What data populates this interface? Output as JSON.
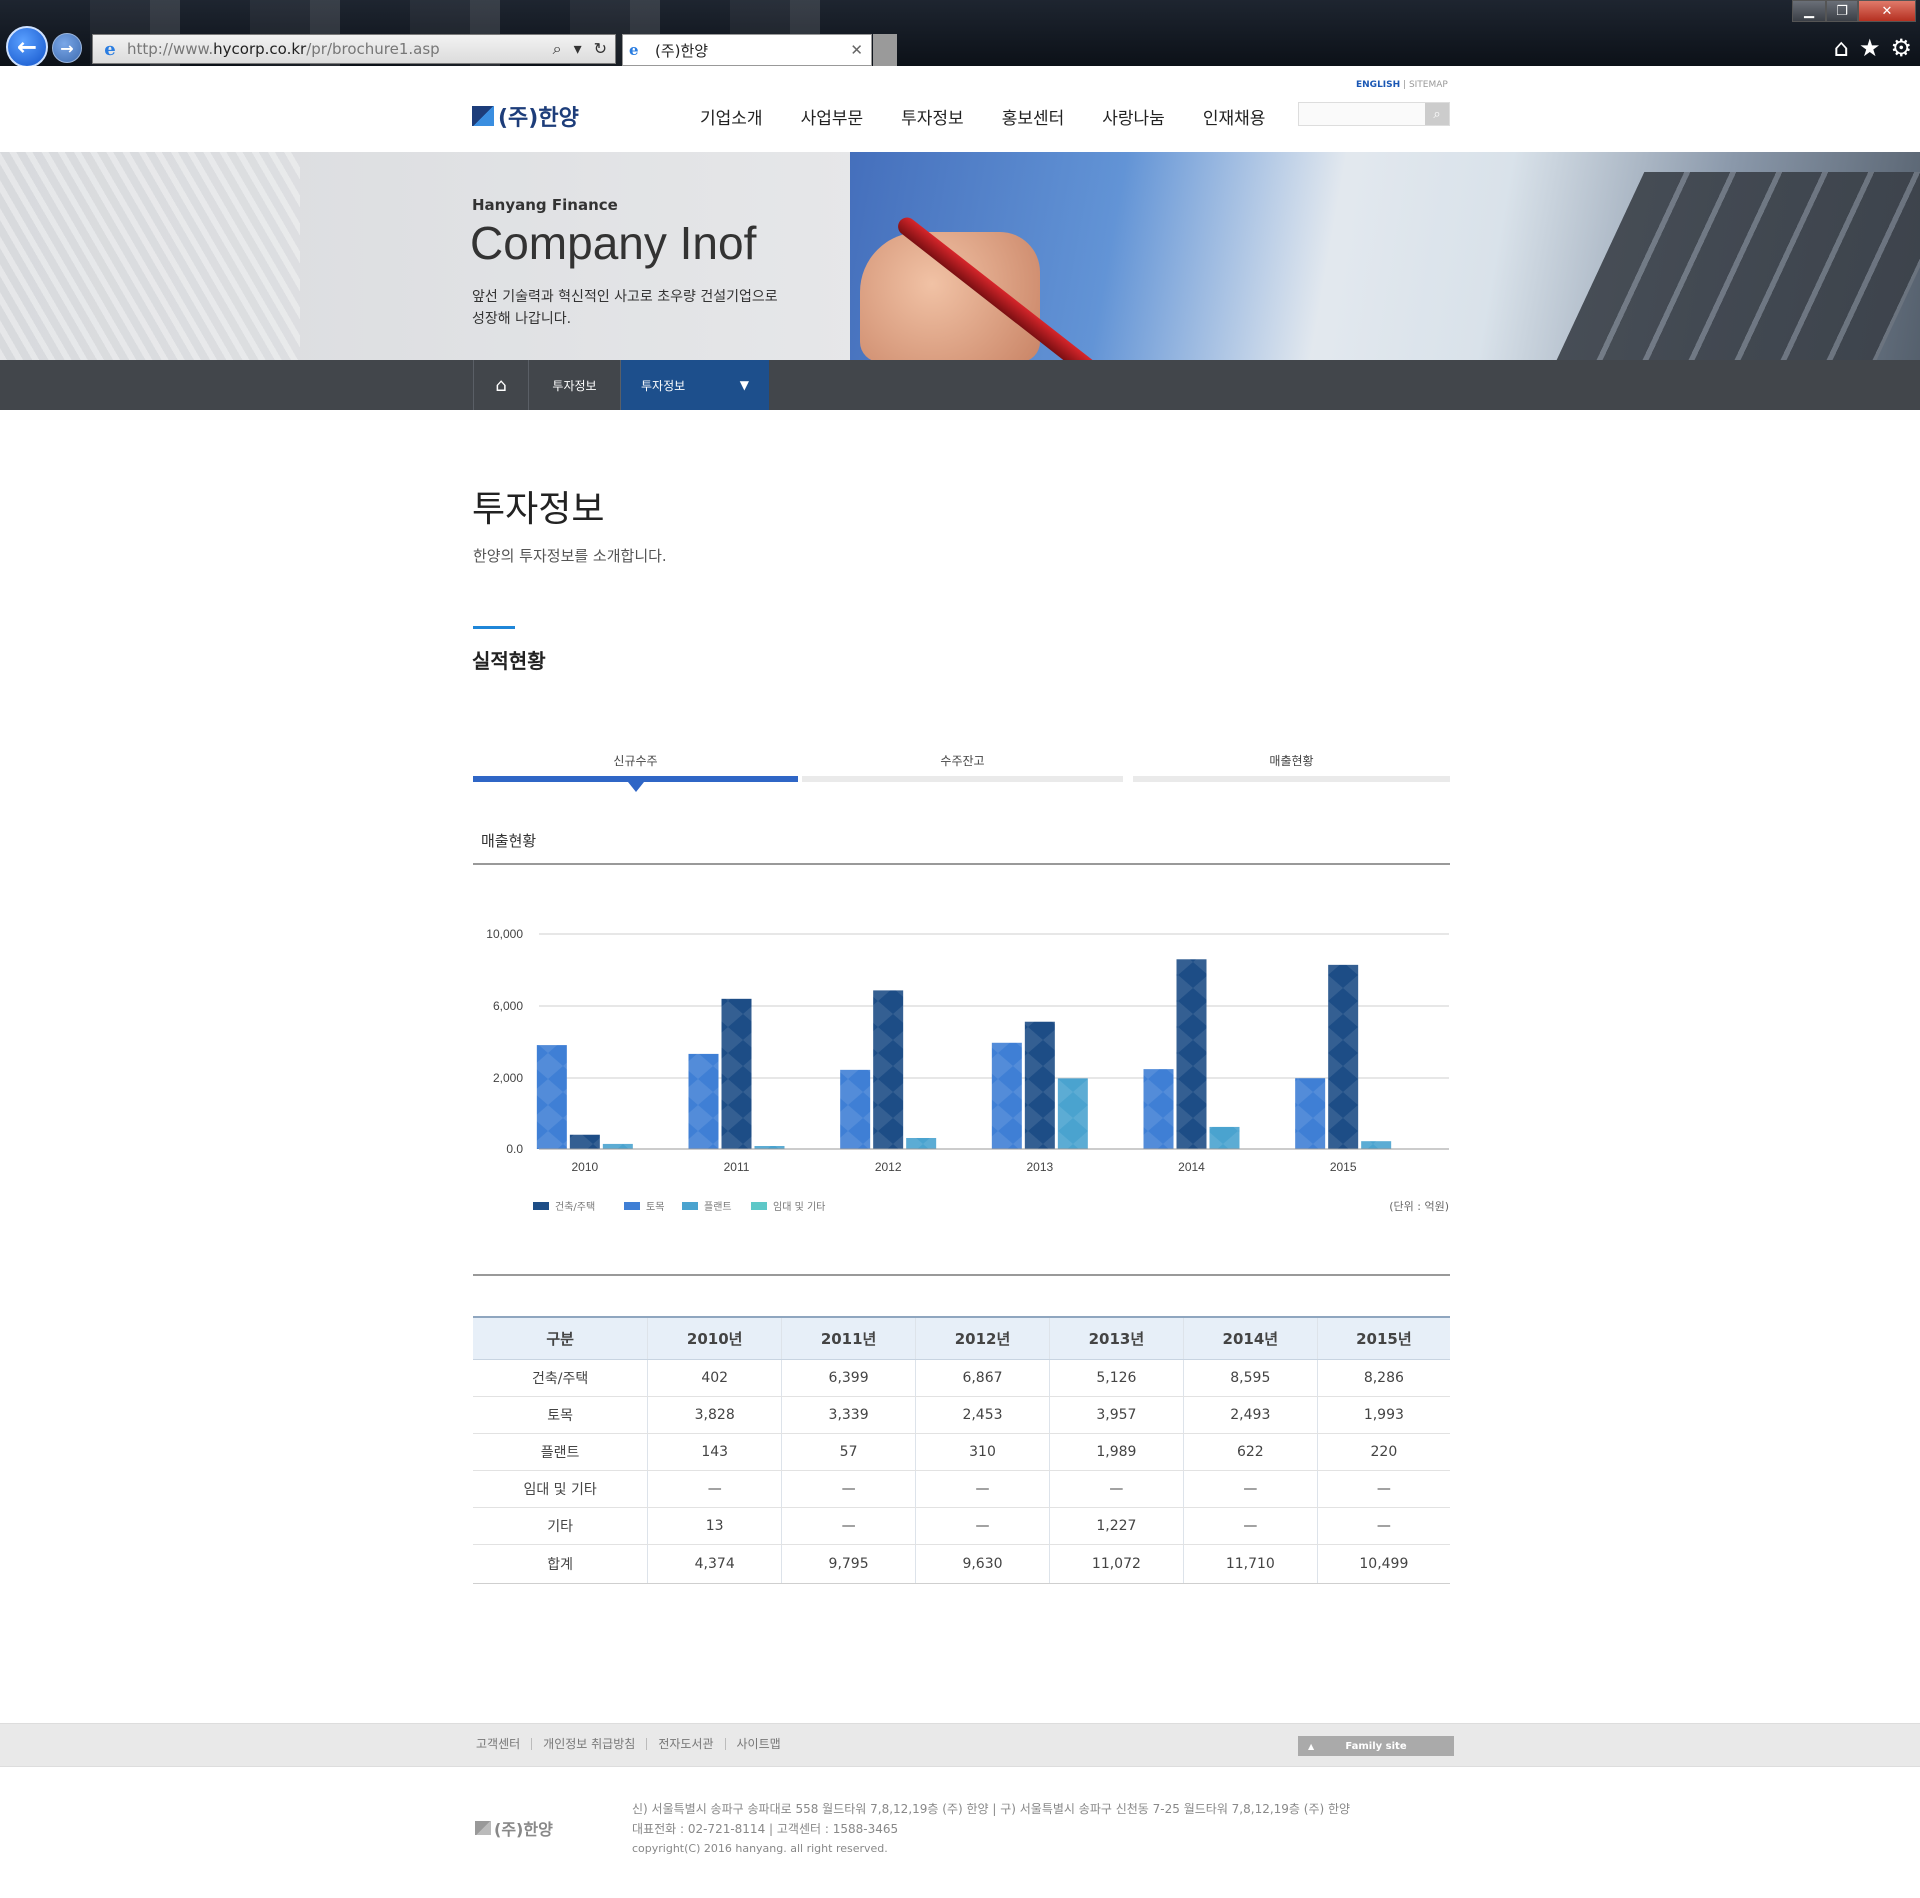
{
  "browser": {
    "url_prefix": "http://www.",
    "url_host": "hycorp.co.kr",
    "url_path": "/pr/brochure1.asp",
    "tab_title": "(주)한양",
    "tab_close": "✕"
  },
  "header": {
    "util_english": "ENGLISH",
    "util_sep": " | ",
    "util_sitemap": "SITEMAP",
    "logo_text": "(주)한양",
    "gnb": [
      "기업소개",
      "사업부문",
      "투자정보",
      "홍보센터",
      "사랑나눔",
      "인재채용"
    ],
    "search_placeholder": ""
  },
  "hero": {
    "subtitle": "Hanyang Finance",
    "title": "Company Inof",
    "desc_line1": "앞선 기술력과 혁신적인 사고로 초우량 건설기업으로",
    "desc_line2": "성장해 나갑니다."
  },
  "location": {
    "home_icon": "home-icon",
    "depth1": "투자정보",
    "depth2": "투자정보"
  },
  "content": {
    "page_title": "투자정보",
    "page_desc": "한양의 투자정보를 소개합니다.",
    "section_title": "실적현황",
    "tabs": [
      "신규수주",
      "수주잔고",
      "매출현황"
    ],
    "chart_heading": "매출현황"
  },
  "chart_data": {
    "type": "bar",
    "categories": [
      "2010",
      "2011",
      "2012",
      "2013",
      "2014",
      "2015"
    ],
    "y_ticks": [
      "10,000",
      "6,000",
      "2,000",
      "0.0"
    ],
    "unit_label": "(단위 : 억원)",
    "grid": true,
    "legend_position": "bottom-left",
    "series": [
      {
        "name": "건축/주택",
        "color": "#1d4d86",
        "values": [
          402,
          6399,
          6867,
          5126,
          8595,
          8286
        ]
      },
      {
        "name": "토목",
        "color": "#3f7fd5",
        "values": [
          3828,
          3339,
          2453,
          3957,
          2493,
          1993
        ]
      },
      {
        "name": "플랜트",
        "color": "#4aa3cf",
        "values": [
          143,
          57,
          310,
          1989,
          622,
          220
        ]
      },
      {
        "name": "임대 및 기타",
        "color": "#5ec8c8",
        "values": [
          0,
          0,
          0,
          0,
          0,
          0
        ]
      }
    ]
  },
  "table": {
    "headers": [
      "구분",
      "2010년",
      "2011년",
      "2012년",
      "2013년",
      "2014년",
      "2015년"
    ],
    "rows": [
      [
        "건축/주택",
        "402",
        "6,399",
        "6,867",
        "5,126",
        "8,595",
        "8,286"
      ],
      [
        "토목",
        "3,828",
        "3,339",
        "2,453",
        "3,957",
        "2,493",
        "1,993"
      ],
      [
        "플랜트",
        "143",
        "57",
        "310",
        "1,989",
        "622",
        "220"
      ],
      [
        "임대 및 기타",
        "—",
        "—",
        "—",
        "—",
        "—",
        "—"
      ],
      [
        "기타",
        "13",
        "—",
        "—",
        "1,227",
        "—",
        "—"
      ],
      [
        "합계",
        "4,374",
        "9,795",
        "9,630",
        "11,072",
        "11,710",
        "10,499"
      ]
    ]
  },
  "footer": {
    "links": [
      "고객센터",
      "개인정보 취급방침",
      "전자도서관",
      "사이트맵"
    ],
    "family_site": "Family site",
    "logo_text": "(주)한양",
    "address": "신) 서울특별시 송파구 송파대로 558 월드타워 7,8,12,19층 (주) 한양  |  구) 서울특별시 송파구 신천동 7-25 월드타워 7,8,12,19층 (주) 한양",
    "phone": "대표전화 : 02-721-8114  |  고객센터 : 1588-3465",
    "copyright": "copyright(C) 2016 hanyang. all right reserved."
  }
}
